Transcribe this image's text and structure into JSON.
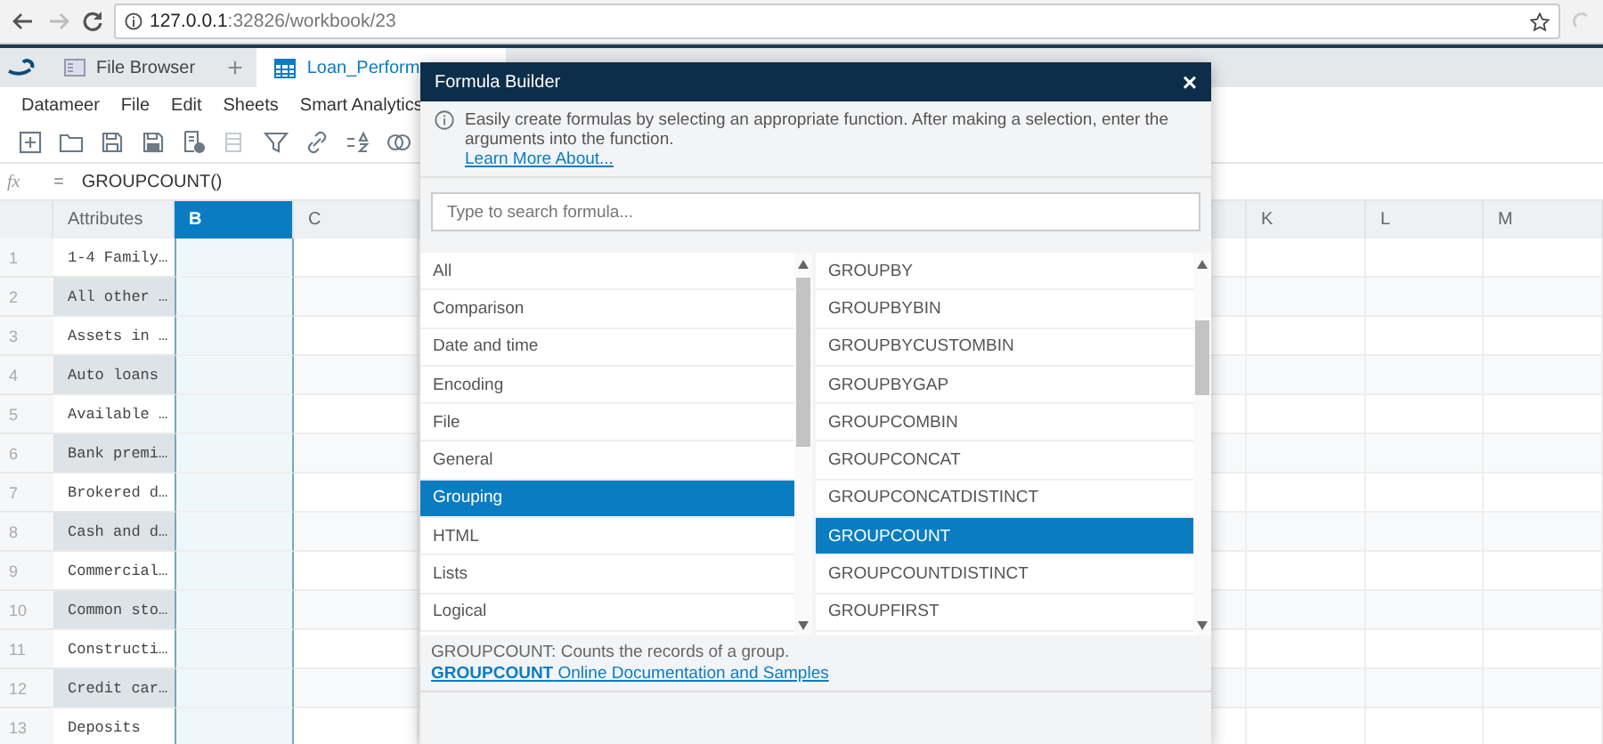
{
  "browser": {
    "url_host": "127.0.0.1",
    "url_rest": ":32826/workbook/23"
  },
  "app_tabs": [
    {
      "kind": "files",
      "label": "File Browser",
      "selected": false
    },
    {
      "kind": "add",
      "label": "+"
    },
    {
      "kind": "sheet",
      "label": "Loan_Perform",
      "selected": true
    }
  ],
  "menu": [
    "Datameer",
    "File",
    "Edit",
    "Sheets",
    "Smart Analytics"
  ],
  "formula_bar": {
    "fx": "fx",
    "equals": "=",
    "value": "GROUPCOUNT()"
  },
  "columns": {
    "left": [
      {
        "label": "Attributes",
        "selected": false
      },
      {
        "label": "B",
        "selected": true
      },
      {
        "label": "C",
        "selected": false
      }
    ],
    "right": [
      {
        "label": "K",
        "selected": false
      },
      {
        "label": "L",
        "selected": false
      },
      {
        "label": "M",
        "selected": false
      }
    ]
  },
  "rows": [
    {
      "number": "1",
      "attribute": "1-4 Family…"
    },
    {
      "number": "2",
      "attribute": "All other …"
    },
    {
      "number": "3",
      "attribute": "Assets in …"
    },
    {
      "number": "4",
      "attribute": "Auto loans"
    },
    {
      "number": "5",
      "attribute": "Available …"
    },
    {
      "number": "6",
      "attribute": "Bank premi…"
    },
    {
      "number": "7",
      "attribute": "Brokered d…"
    },
    {
      "number": "8",
      "attribute": "Cash and d…"
    },
    {
      "number": "9",
      "attribute": "Commercial…"
    },
    {
      "number": "10",
      "attribute": "Common sto…"
    },
    {
      "number": "11",
      "attribute": "Constructi…"
    },
    {
      "number": "12",
      "attribute": "Credit car…"
    },
    {
      "number": "13",
      "attribute": "Deposits"
    }
  ],
  "formula_builder": {
    "title": "Formula Builder",
    "close": "×",
    "info": "Easily create formulas by selecting an appropriate function. After making a selection, enter the arguments into the function.",
    "learn_more": "Learn More About...",
    "search": {
      "placeholder": "Type to search formula..."
    },
    "categories": [
      {
        "label": "All",
        "selected": false
      },
      {
        "label": "Comparison",
        "selected": false
      },
      {
        "label": "Date and time",
        "selected": false
      },
      {
        "label": "Encoding",
        "selected": false
      },
      {
        "label": "File",
        "selected": false
      },
      {
        "label": "General",
        "selected": false
      },
      {
        "label": "Grouping",
        "selected": true
      },
      {
        "label": "HTML",
        "selected": false
      },
      {
        "label": "Lists",
        "selected": false
      },
      {
        "label": "Logical",
        "selected": false
      }
    ],
    "functions": [
      {
        "label": "GROUPBY",
        "selected": false
      },
      {
        "label": "GROUPBYBIN",
        "selected": false
      },
      {
        "label": "GROUPBYCUSTOMBIN",
        "selected": false
      },
      {
        "label": "GROUPBYGAP",
        "selected": false
      },
      {
        "label": "GROUPCOMBIN",
        "selected": false
      },
      {
        "label": "GROUPCONCAT",
        "selected": false
      },
      {
        "label": "GROUPCONCATDISTINCT",
        "selected": false
      },
      {
        "label": "GROUPCOUNT",
        "selected": true
      },
      {
        "label": "GROUPCOUNTDISTINCT",
        "selected": false
      },
      {
        "label": "GROUPFIRST",
        "selected": false
      }
    ],
    "description": "GROUPCOUNT: Counts the records of a group.",
    "doc_link": "**GROUPCOUNT** Online Documentation and Samples"
  }
}
